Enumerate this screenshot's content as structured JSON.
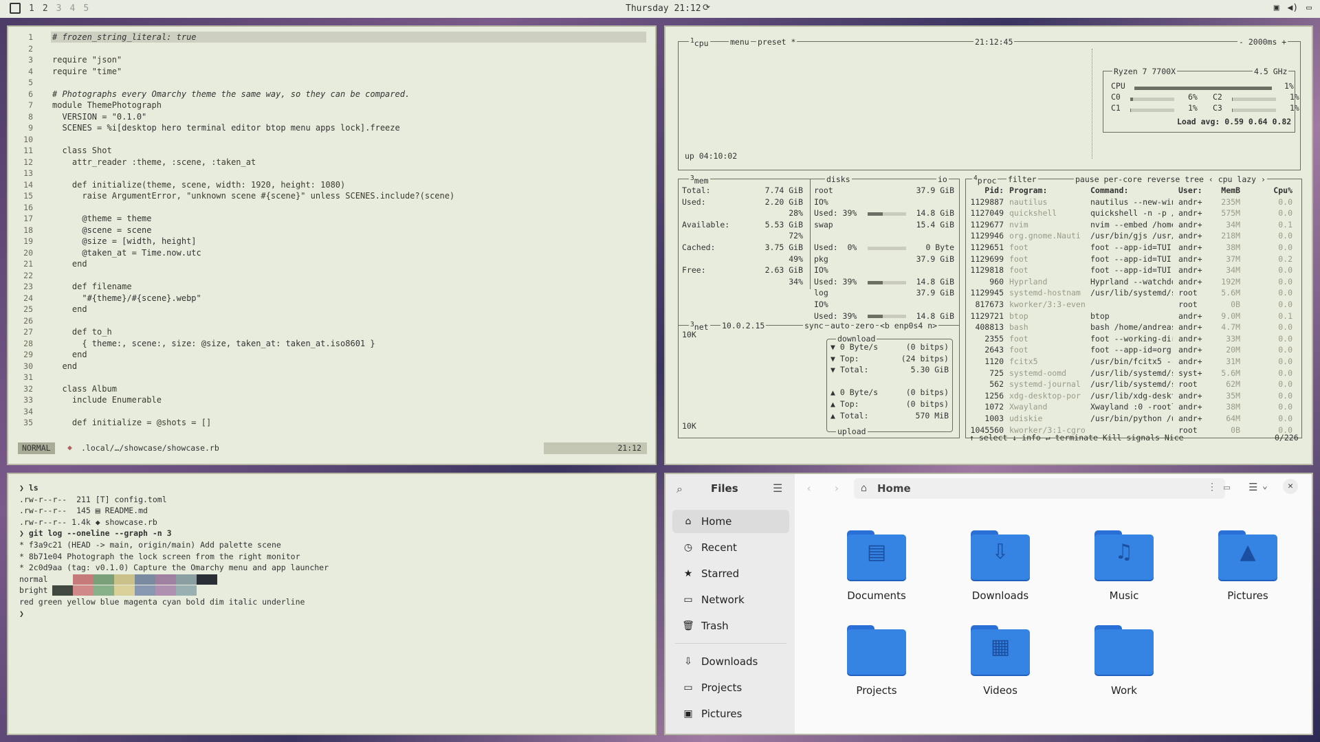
{
  "topbar": {
    "workspaces": [
      "1",
      "2",
      "3",
      "4",
      "5"
    ],
    "clock": "Thursday 21:12"
  },
  "editor": {
    "lines": [
      {
        "n": "1",
        "t": "# frozen_string_literal: true"
      },
      {
        "n": "2",
        "t": ""
      },
      {
        "n": "3",
        "t": "require \"json\""
      },
      {
        "n": "4",
        "t": "require \"time\""
      },
      {
        "n": "5",
        "t": ""
      },
      {
        "n": "6",
        "t": "# Photographs every Omarchy theme the same way, so they can be compared."
      },
      {
        "n": "7",
        "t": "module ThemePhotograph"
      },
      {
        "n": "8",
        "t": "  VERSION = \"0.1.0\""
      },
      {
        "n": "9",
        "t": "  SCENES = %i[desktop hero terminal editor btop menu apps lock].freeze"
      },
      {
        "n": "10",
        "t": ""
      },
      {
        "n": "11",
        "t": "  class Shot"
      },
      {
        "n": "12",
        "t": "    attr_reader :theme, :scene, :taken_at"
      },
      {
        "n": "13",
        "t": ""
      },
      {
        "n": "14",
        "t": "    def initialize(theme, scene, width: 1920, height: 1080)"
      },
      {
        "n": "15",
        "t": "      raise ArgumentError, \"unknown scene #{scene}\" unless SCENES.include?(scene)"
      },
      {
        "n": "16",
        "t": ""
      },
      {
        "n": "17",
        "t": "      @theme = theme"
      },
      {
        "n": "18",
        "t": "      @scene = scene"
      },
      {
        "n": "19",
        "t": "      @size = [width, height]"
      },
      {
        "n": "20",
        "t": "      @taken_at = Time.now.utc"
      },
      {
        "n": "21",
        "t": "    end"
      },
      {
        "n": "22",
        "t": ""
      },
      {
        "n": "23",
        "t": "    def filename"
      },
      {
        "n": "24",
        "t": "      \"#{theme}/#{scene}.webp\""
      },
      {
        "n": "25",
        "t": "    end"
      },
      {
        "n": "26",
        "t": ""
      },
      {
        "n": "27",
        "t": "    def to_h"
      },
      {
        "n": "28",
        "t": "      { theme:, scene:, size: @size, taken_at: taken_at.iso8601 }"
      },
      {
        "n": "29",
        "t": "    end"
      },
      {
        "n": "30",
        "t": "  end"
      },
      {
        "n": "31",
        "t": ""
      },
      {
        "n": "32",
        "t": "  class Album"
      },
      {
        "n": "33",
        "t": "    include Enumerable"
      },
      {
        "n": "34",
        "t": ""
      },
      {
        "n": "35",
        "t": "    def initialize = @shots = []"
      }
    ],
    "mode": "NORMAL",
    "file": ".local/…/showcase/showcase.rb",
    "time": "21:12"
  },
  "btop": {
    "cpu": {
      "tab": "cpu",
      "menu": "menu",
      "preset": "preset *",
      "clock": "21:12:45",
      "interval": "- 2000ms +",
      "model": "Ryzen 7 7700X",
      "freq": "4.5 GHz",
      "uptime": "up 04:10:02",
      "load": "Load avg: 0.59 0.64 0.82",
      "cores": [
        {
          "n": "CPU",
          "v": "1%"
        },
        {
          "n": "C0",
          "v": "6%"
        },
        {
          "n": "C1",
          "v": "1%"
        },
        {
          "n": "C2",
          "v": "1%"
        },
        {
          "n": "C3",
          "v": "1%"
        }
      ]
    },
    "mem": {
      "title": "mem",
      "total": "7.74 GiB",
      "used": "2.20 GiB",
      "used_pct": "28%",
      "avail": "5.53 GiB",
      "avail_pct": "72%",
      "cached": "3.75 GiB",
      "cached_pct": "49%",
      "free": "2.63 GiB",
      "free_pct": "34%"
    },
    "disks": {
      "title": "disks",
      "io": "io",
      "items": [
        {
          "name": "root",
          "size": "37.9 GiB",
          "io": "IO%",
          "used": "Used: 39%",
          "usedv": "14.8 GiB",
          "pct": 0.39
        },
        {
          "name": "swap",
          "size": "15.4 GiB",
          "io": "",
          "used": "Used:  0%",
          "usedv": "0 Byte",
          "pct": 0.0
        },
        {
          "name": "pkg",
          "size": "37.9 GiB",
          "io": "IO%",
          "used": "Used: 39%",
          "usedv": "14.8 GiB",
          "pct": 0.39
        },
        {
          "name": "log",
          "size": "37.9 GiB",
          "io": "IO%",
          "used": "Used: 39%",
          "usedv": "14.8 GiB",
          "pct": 0.39
        }
      ]
    },
    "net": {
      "title": "net",
      "ip": "10.0.2.15",
      "sync": "sync",
      "auto": "auto",
      "zero": "zero",
      "iface": "<b enp0s4 n>",
      "scale_top": "10K",
      "scale_bot": "10K",
      "download": "download",
      "upload": "upload",
      "rows": [
        [
          "▼ 0 Byte/s",
          "(0 bitps)"
        ],
        [
          "▼ Top:",
          "(24 bitps)"
        ],
        [
          "▼ Total:",
          "5.30 GiB"
        ],
        [
          "▲ 0 Byte/s",
          "(0 bitps)"
        ],
        [
          "▲ Top:",
          "(0 bitps)"
        ],
        [
          "▲ Total:",
          "570 MiB"
        ]
      ]
    },
    "proc": {
      "title": "proc",
      "filter": "filter",
      "opts": "pause per-core reverse tree ‹ cpu lazy ›",
      "headers": [
        "Pid:",
        "Program:",
        "Command:",
        "User:",
        "MemB",
        "Cpu%"
      ],
      "rows": [
        [
          "1129887",
          "nautilus",
          "nautilus --new-win",
          "andr+",
          "235M",
          "0.0"
        ],
        [
          "1127049",
          "quickshell",
          "quickshell -n -p /",
          "andr+",
          "575M",
          "0.0"
        ],
        [
          "1129677",
          "nvim",
          "nvim --embed /home",
          "andr+",
          "34M",
          "0.1"
        ],
        [
          "1129946",
          "org.gnome.Nauti",
          "/usr/bin/gjs /usr/",
          "andr+",
          "218M",
          "0.0"
        ],
        [
          "1129651",
          "foot",
          "foot --app-id=TUI.",
          "andr+",
          "38M",
          "0.0"
        ],
        [
          "1129699",
          "foot",
          "foot --app-id=TUI.",
          "andr+",
          "37M",
          "0.2"
        ],
        [
          "1129818",
          "foot",
          "foot --app-id=TUI.",
          "andr+",
          "34M",
          "0.0"
        ],
        [
          "960",
          "Hyprland",
          "Hyprland --watchdo",
          "andr+",
          "192M",
          "0.0"
        ],
        [
          "1129945",
          "systemd-hostnam",
          "/usr/lib/systemd/s",
          "root",
          "5.6M",
          "0.0"
        ],
        [
          "817673",
          "kworker/3:3-even",
          "",
          "root",
          "0B",
          "0.0"
        ],
        [
          "1129721",
          "btop",
          "btop",
          "andr+",
          "9.0M",
          "0.1"
        ],
        [
          "408813",
          "bash",
          "bash /home/andreas",
          "andr+",
          "4.7M",
          "0.0"
        ],
        [
          "2355",
          "foot",
          "foot --working-dir",
          "andr+",
          "33M",
          "0.0"
        ],
        [
          "2643",
          "foot",
          "foot --app-id=org.",
          "andr+",
          "20M",
          "0.0"
        ],
        [
          "1120",
          "fcitx5",
          "/usr/bin/fcitx5 --",
          "andr+",
          "31M",
          "0.0"
        ],
        [
          "725",
          "systemd-oomd",
          "/usr/lib/systemd/s",
          "syst+",
          "5.6M",
          "0.0"
        ],
        [
          "562",
          "systemd-journal",
          "/usr/lib/systemd/s",
          "root",
          "62M",
          "0.0"
        ],
        [
          "1256",
          "xdg-desktop-por",
          "/usr/lib/xdg-deskt",
          "andr+",
          "35M",
          "0.0"
        ],
        [
          "1072",
          "Xwayland",
          "Xwayland :0 -rootl",
          "andr+",
          "38M",
          "0.0"
        ],
        [
          "1003",
          "udiskie",
          "/usr/bin/python /u",
          "andr+",
          "64M",
          "0.0"
        ],
        [
          "1045560",
          "kworker/3:1-cgro",
          "",
          "root",
          "0B",
          "0.0"
        ]
      ],
      "footer": "↑ select ↓ info ↵ terminate Kill signals Nice",
      "count": "0/226"
    }
  },
  "terminal": {
    "lines": [
      "❯ ls",
      ".rw-r--r--  211 [T] config.toml",
      ".rw-r--r--  145 ▤ README.md",
      ".rw-r--r-- 1.4k ◆ showcase.rb",
      "❯ git log --oneline --graph -n 3",
      "* f3a9c21 (HEAD -> main, origin/main) Add palette scene",
      "* 8b71e04 Photograph the lock screen from the right monitor",
      "* 2c0d9aa (tag: v0.1.0) Capture the Omarchy menu and app launcher",
      "normal",
      "bright",
      "red green yellow blue magenta cyan bold dim italic underline",
      "❯"
    ],
    "palette_normal": [
      "#e8ecdd",
      "#c77a7a",
      "#7aa07a",
      "#c9c08a",
      "#7a8aa0",
      "#a080a0",
      "#8aa0a0",
      "#2a2e35"
    ],
    "palette_bright": [
      "#404840",
      "#d08888",
      "#88b088",
      "#d8d098",
      "#8898b0",
      "#b090b0",
      "#98b0b0"
    ]
  },
  "files": {
    "title": "Files",
    "path": "Home",
    "sidebar": [
      {
        "label": "Home",
        "icon": "⌂"
      },
      {
        "label": "Recent",
        "icon": "◷"
      },
      {
        "label": "Starred",
        "icon": "★"
      },
      {
        "label": "Network",
        "icon": "▭"
      },
      {
        "label": "Trash",
        "icon": "🗑"
      },
      {
        "label": "Downloads",
        "icon": "⇩"
      },
      {
        "label": "Projects",
        "icon": "▭"
      },
      {
        "label": "Pictures",
        "icon": "▣"
      }
    ],
    "folders": [
      {
        "label": "Documents",
        "glyph": "▤"
      },
      {
        "label": "Downloads",
        "glyph": "⇩"
      },
      {
        "label": "Music",
        "glyph": "♫"
      },
      {
        "label": "Pictures",
        "glyph": "▲"
      },
      {
        "label": "Projects",
        "glyph": ""
      },
      {
        "label": "Videos",
        "glyph": "▦"
      },
      {
        "label": "Work",
        "glyph": ""
      }
    ]
  }
}
